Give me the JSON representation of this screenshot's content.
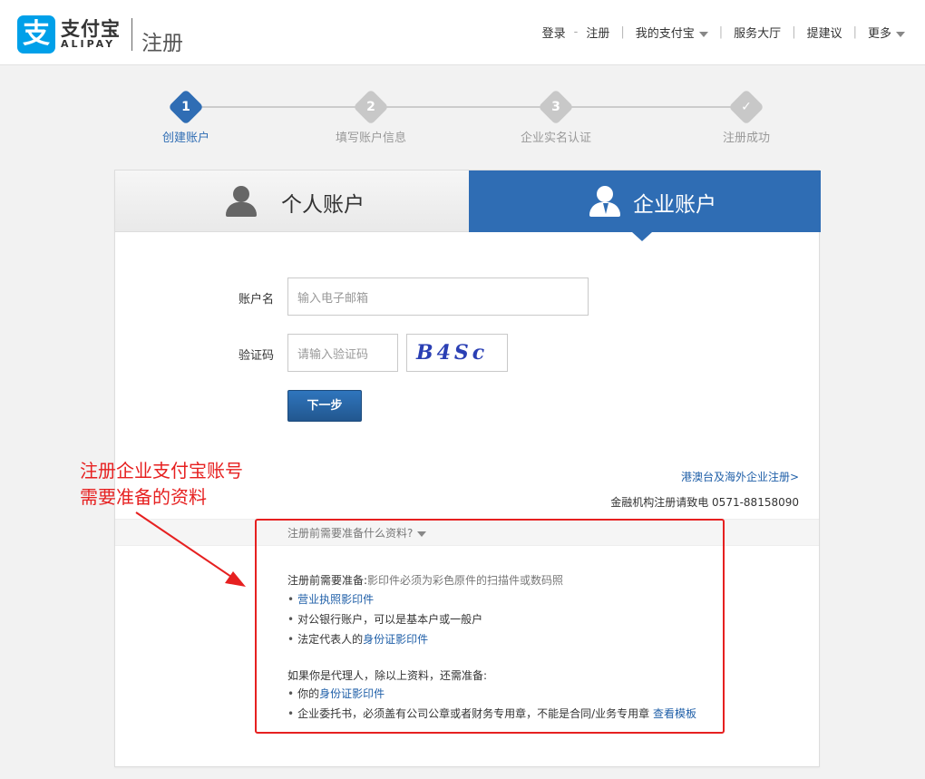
{
  "header": {
    "logo_mark": "支",
    "logo_cn": "支付宝",
    "logo_en": "ALIPAY",
    "page_label": "注册",
    "nav": {
      "login": "登录",
      "dash": "-",
      "register": "注册",
      "my_alipay": "我的支付宝",
      "service_hall": "服务大厅",
      "feedback": "提建议",
      "more": "更多"
    }
  },
  "steps": [
    {
      "num": "1",
      "label": "创建账户",
      "active": true
    },
    {
      "num": "2",
      "label": "填写账户信息",
      "active": false
    },
    {
      "num": "3",
      "label": "企业实名认证",
      "active": false
    },
    {
      "num": "✓",
      "label": "注册成功",
      "active": false
    }
  ],
  "tabs": {
    "personal": "个人账户",
    "business": "企业账户"
  },
  "form": {
    "account_label": "账户名",
    "account_placeholder": "输入电子邮箱",
    "captcha_label": "验证码",
    "captcha_placeholder": "请输入验证码",
    "captcha_text": "B4Sc",
    "next_button": "下一步"
  },
  "links": {
    "overseas": "港澳台及海外企业注册>",
    "hotline": "金融机构注册请致电 0571-88158090"
  },
  "prep": {
    "toggle": "注册前需要准备什么资料?",
    "intro_label": "注册前需要准备:",
    "intro_note": "影印件必须为彩色原件的扫描件或数码照",
    "item1_link": "营业执照影印件",
    "item2": "对公银行账户，可以是基本户或一般户",
    "item3_prefix": "法定代表人的",
    "item3_link": "身份证影印件",
    "agent_intro": "如果你是代理人，除以上资料，还需准备:",
    "agent_item1_prefix": "你的",
    "agent_item1_link": "身份证影印件",
    "agent_item2": "企业委托书，必须盖有公司公章或者财务专用章，不能是合同/业务专用章",
    "agent_item2_link": "查看模板",
    "bullet": "•"
  },
  "annotation": {
    "line1": "注册企业支付宝账号",
    "line2": "需要准备的资料",
    "color": "#e62020"
  },
  "colors": {
    "brand_blue": "#00a0e9",
    "primary": "#2f6db4",
    "link": "#1f5fa8"
  }
}
